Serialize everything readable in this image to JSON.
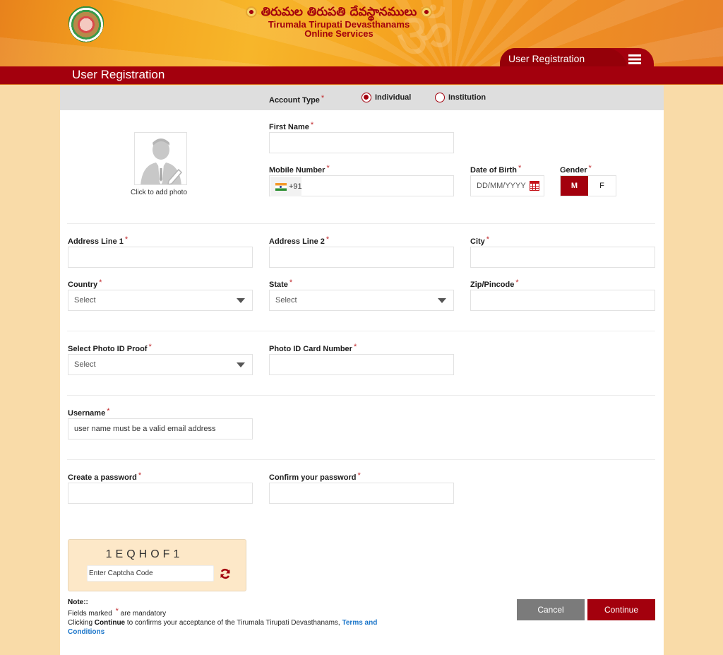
{
  "header": {
    "telugu_title": "తిరుమల తిరుపతి దేవస్థానములు",
    "org_name": "Tirumala Tirupati Devasthanams",
    "subtitle": "Online Services",
    "nav_tab_label": "User Registration",
    "menu_icon": "hamburger-menu-icon"
  },
  "page_title": "User Registration",
  "form": {
    "account_type": {
      "label": "Account Type",
      "options": [
        {
          "label": "Individual",
          "selected": true
        },
        {
          "label": "Institution",
          "selected": false
        }
      ]
    },
    "photo": {
      "caption": "Click to add photo",
      "icon": "user-avatar-icon"
    },
    "first_name": {
      "label": "First Name",
      "value": ""
    },
    "mobile": {
      "label": "Mobile Number",
      "country_code": "+91",
      "flag": "india-flag-icon",
      "value": ""
    },
    "dob": {
      "label": "Date of Birth",
      "placeholder": "DD/MM/YYYY",
      "icon": "calendar-icon"
    },
    "gender": {
      "label": "Gender",
      "options": [
        "M",
        "F"
      ],
      "selected": "M"
    },
    "address1": {
      "label": "Address Line 1",
      "value": ""
    },
    "address2": {
      "label": "Address Line 2",
      "value": ""
    },
    "city": {
      "label": "City",
      "value": ""
    },
    "country": {
      "label": "Country",
      "selected": "Select"
    },
    "state": {
      "label": "State",
      "selected": "Select"
    },
    "zip": {
      "label": "Zip/Pincode",
      "value": ""
    },
    "photo_id_proof": {
      "label": "Select Photo ID Proof",
      "selected": "Select"
    },
    "photo_id_number": {
      "label": "Photo ID Card Number",
      "value": ""
    },
    "username": {
      "label": "Username",
      "placeholder": "user name must be a valid email address"
    },
    "password": {
      "label": "Create a password",
      "value": ""
    },
    "confirm_password": {
      "label": "Confirm your password",
      "value": ""
    },
    "required_marker": "*"
  },
  "captcha": {
    "code": "1EQHOF1",
    "placeholder": "Enter Captcha Code",
    "refresh_icon": "refresh-icon"
  },
  "note": {
    "title": "Note::",
    "mandatory_prefix": "Fields marked",
    "mandatory_suffix": "are mandatory",
    "consent_prefix": "Clicking",
    "consent_bold": "Continue",
    "consent_text": "to confirms your acceptance of the Tirumala Tirupati Devasthanams,",
    "link_text": "Terms and Conditions"
  },
  "buttons": {
    "cancel": "Cancel",
    "continue": "Continue"
  },
  "colors": {
    "brand_red": "#a3000d",
    "background_peach": "#f9dba8",
    "cancel_gray": "#7b7b7b",
    "link_blue": "#1a75c9",
    "required_red": "#c0282b"
  }
}
